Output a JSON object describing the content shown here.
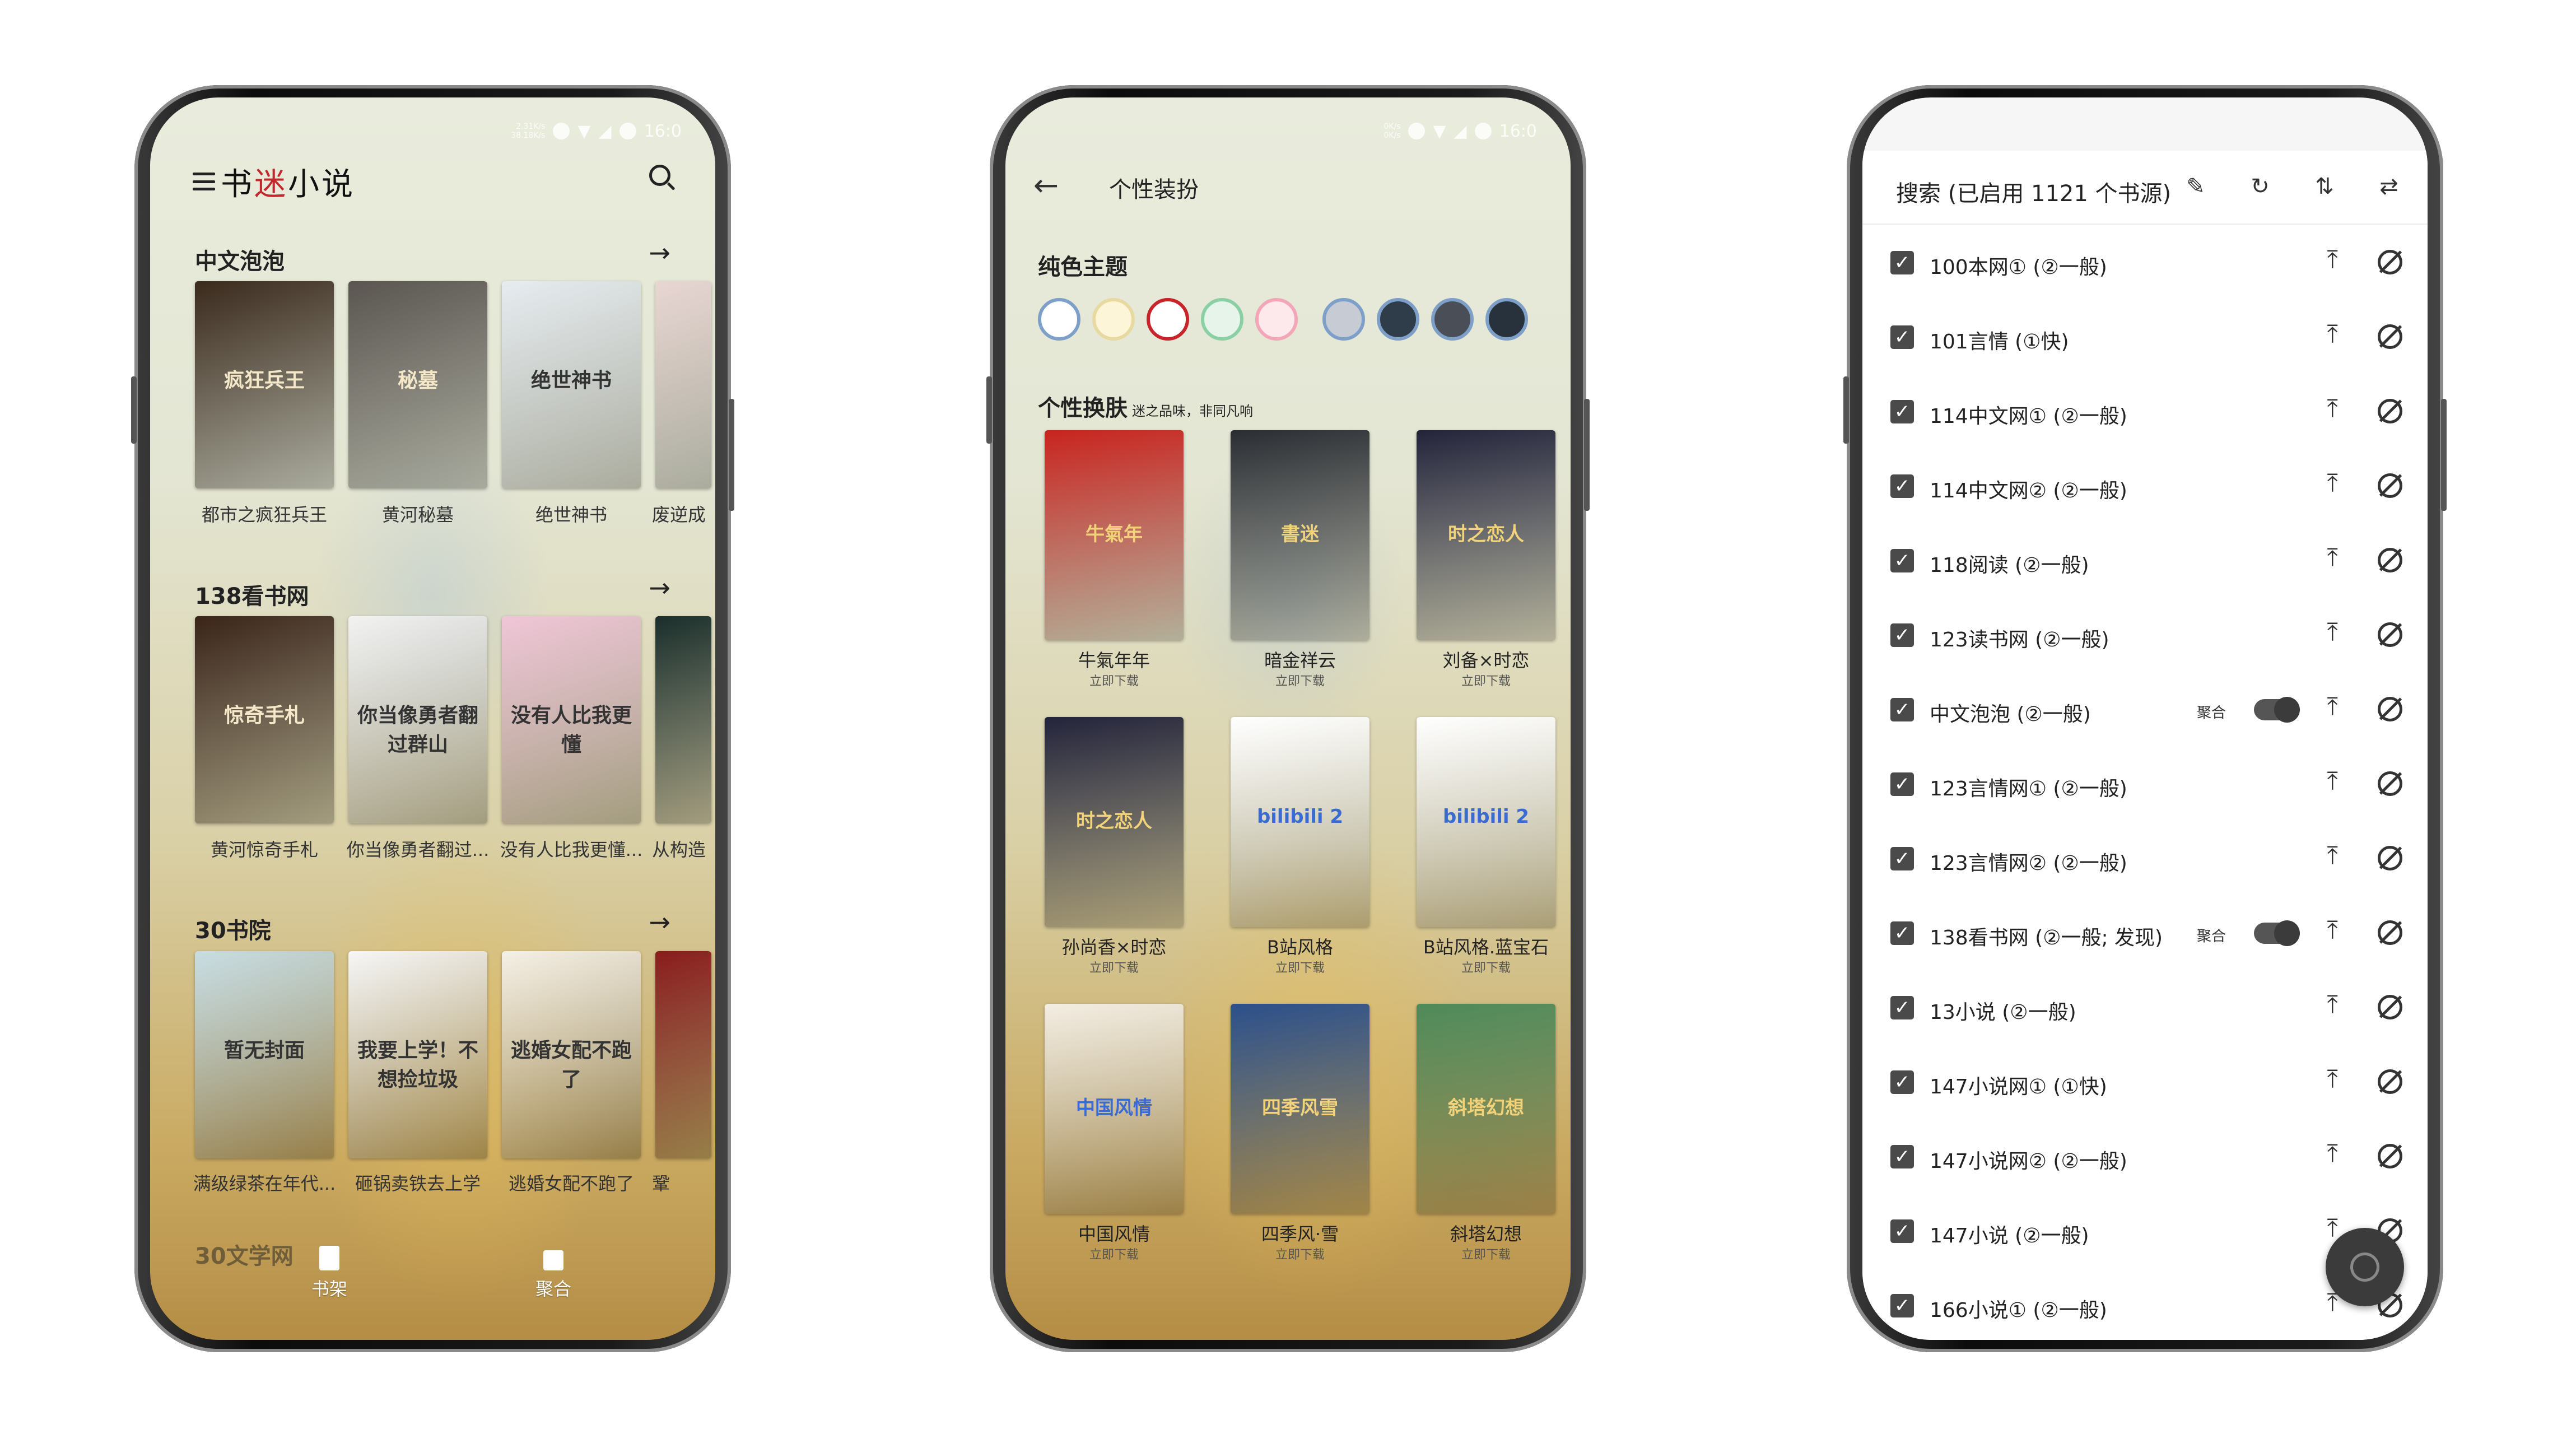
{
  "phone1": {
    "status": {
      "speed": "2.31K/s",
      "speed2": "38.18K/s",
      "time": "16:0"
    },
    "app_title_a": "书",
    "app_title_b": "迷",
    "app_title_c": "小说",
    "sections": [
      {
        "title": "中文泡泡",
        "books": [
          "都市之疯狂兵王",
          "黄河秘墓",
          "绝世神书",
          "废逆成"
        ]
      },
      {
        "title": "138看书网",
        "books": [
          "黄河惊奇手札",
          "你当像勇者翻过...",
          "没有人比我更懂...",
          "从构造"
        ]
      },
      {
        "title": "30书院",
        "books": [
          "满级绿茶在年代...",
          "砸锅卖铁去上学",
          "逃婚女配不跑了",
          "鞏"
        ]
      }
    ],
    "covers": [
      {
        "text": "疯狂兵王",
        "color": "#3a2a1c"
      },
      {
        "text": "秘墓",
        "color": "#5a5550"
      },
      {
        "text": "绝世神书",
        "color": "#e6ecf0"
      },
      {
        "text": "",
        "color": "#e8d6d2"
      },
      {
        "text": "惊奇手札",
        "color": "#3a2418"
      },
      {
        "text": "你当像勇者翻过群山",
        "color": "#f2f2f2"
      },
      {
        "text": "没有人比我更懂",
        "color": "#f0c6d6"
      },
      {
        "text": "",
        "color": "#1a2e2a"
      },
      {
        "text": "暂无封面",
        "color": "#c8dde2"
      },
      {
        "text": "我要上学！不想捡垃圾",
        "color": "#f6f6f6"
      },
      {
        "text": "逃婚女配不跑了",
        "color": "#f5f0e6"
      },
      {
        "text": "",
        "color": "#8a1c1c"
      }
    ],
    "next_section": "30文学网",
    "nav": [
      {
        "label": "书架"
      },
      {
        "label": "聚合"
      }
    ]
  },
  "phone2": {
    "status": {
      "speed": "0K/s",
      "speed2": "0K/s",
      "time": "16:0"
    },
    "title": "个性装扮",
    "solid_theme": "纯色主题",
    "swatches": [
      "#ffffff",
      "#fdf5d8",
      "#ffffff",
      "#e6f4ea",
      "#fde8ec",
      "#c7ccd4",
      "#2f3c4a",
      "#4a4f57",
      "#27323d"
    ],
    "skin_title": "个性换肤",
    "skin_subtitle": "迷之品味，非同凡响",
    "skins": [
      {
        "name": "牛氣年年",
        "action": "立即下载",
        "color": "#c8241e",
        "text": "牛氣年"
      },
      {
        "name": "暗金祥云",
        "action": "立即下载",
        "color": "#2a2d33",
        "text": "書迷"
      },
      {
        "name": "刘备×时恋",
        "action": "立即下载",
        "color": "#23243a",
        "text": "时之恋人"
      },
      {
        "name": "孙尚香×时恋",
        "action": "立即下载",
        "color": "#23243a",
        "text": "时之恋人"
      },
      {
        "name": "B站风格",
        "action": "立即下载",
        "color": "#ffffff",
        "text": "bilibili 2"
      },
      {
        "name": "B站风格.蓝宝石",
        "action": "立即下载",
        "color": "#ffffff",
        "text": "bilibili 2"
      },
      {
        "name": "中国风情",
        "action": "立即下载",
        "color": "#f3ede2",
        "text": "中国风情"
      },
      {
        "name": "四季风·雪",
        "action": "立即下载",
        "color": "#2c4f8a",
        "text": "四季风雪"
      },
      {
        "name": "斜塔幻想",
        "action": "立即下载",
        "color": "#4f8a5a",
        "text": "斜塔幻想"
      }
    ]
  },
  "phone3": {
    "title": "搜索 (已启用 1121 个书源)",
    "sources": [
      {
        "label": "100本网① (②一般)",
        "juhe": false
      },
      {
        "label": "101言情 (①快)",
        "juhe": false
      },
      {
        "label": "114中文网① (②一般)",
        "juhe": false
      },
      {
        "label": "114中文网② (②一般)",
        "juhe": false
      },
      {
        "label": "118阅读 (②一般)",
        "juhe": false
      },
      {
        "label": "123读书网 (②一般)",
        "juhe": false
      },
      {
        "label": "中文泡泡 (②一般)",
        "juhe": true
      },
      {
        "label": "123言情网① (②一般)",
        "juhe": false
      },
      {
        "label": "123言情网② (②一般)",
        "juhe": false
      },
      {
        "label": "138看书网 (②一般; 发现)",
        "juhe": true
      },
      {
        "label": "13小说 (②一般)",
        "juhe": false
      },
      {
        "label": "147小说网① (①快)",
        "juhe": false
      },
      {
        "label": "147小说网② (②一般)",
        "juhe": false
      },
      {
        "label": "147小说 (②一般)",
        "juhe": false
      },
      {
        "label": "166小说① (②一般)",
        "juhe": false
      }
    ],
    "juhe_label": "聚合"
  }
}
